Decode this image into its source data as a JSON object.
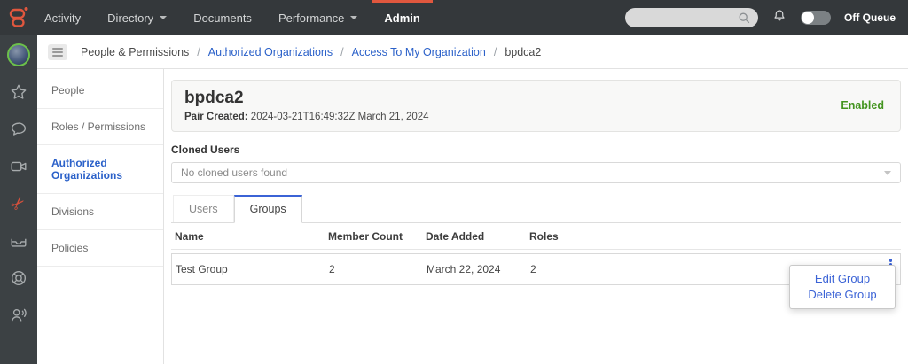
{
  "topbar": {
    "nav": [
      {
        "label": "Activity",
        "caret": false,
        "active": false
      },
      {
        "label": "Directory",
        "caret": true,
        "active": false
      },
      {
        "label": "Documents",
        "caret": false,
        "active": false
      },
      {
        "label": "Performance",
        "caret": true,
        "active": false
      },
      {
        "label": "Admin",
        "caret": false,
        "active": true
      }
    ],
    "search_value": "",
    "off_queue_label": "Off Queue"
  },
  "rail": {
    "icons": [
      "user-avatar",
      "favorites-star",
      "chat",
      "video",
      "collaborate",
      "inbox",
      "help",
      "agent-voice"
    ]
  },
  "breadcrumb": {
    "sep": "/",
    "items": [
      {
        "label": "People & Permissions",
        "link": false
      },
      {
        "label": "Authorized Organizations",
        "link": true
      },
      {
        "label": "Access To My Organization",
        "link": true
      },
      {
        "label": "bpdca2",
        "link": false
      }
    ]
  },
  "sidebar": {
    "items": [
      "People",
      "Roles / Permissions",
      "Authorized Organizations",
      "Divisions",
      "Policies"
    ],
    "active": "Authorized Organizations"
  },
  "main": {
    "pair": {
      "title": "bpdca2",
      "created_label": "Pair Created:",
      "created_value": "2024-03-21T16:49:32Z March 21, 2024",
      "status": "Enabled"
    },
    "cloned_users": {
      "label": "Cloned Users",
      "value": "No cloned users found"
    },
    "tabs": [
      "Users",
      "Groups"
    ],
    "active_tab": "Groups",
    "table": {
      "columns": [
        "Name",
        "Member Count",
        "Date Added",
        "Roles"
      ],
      "rows": [
        {
          "name": "Test Group",
          "member_count": "2",
          "date_added": "March 22, 2024",
          "roles": "2"
        }
      ]
    },
    "context_menu": {
      "items": [
        "Edit Group",
        "Delete Group"
      ]
    }
  },
  "colors": {
    "brand_orange": "#e0573e",
    "link_blue": "#2b61c9",
    "active_tab_blue": "#3b63d6",
    "enabled_green": "#43941f",
    "topbar_bg": "#34383b"
  }
}
